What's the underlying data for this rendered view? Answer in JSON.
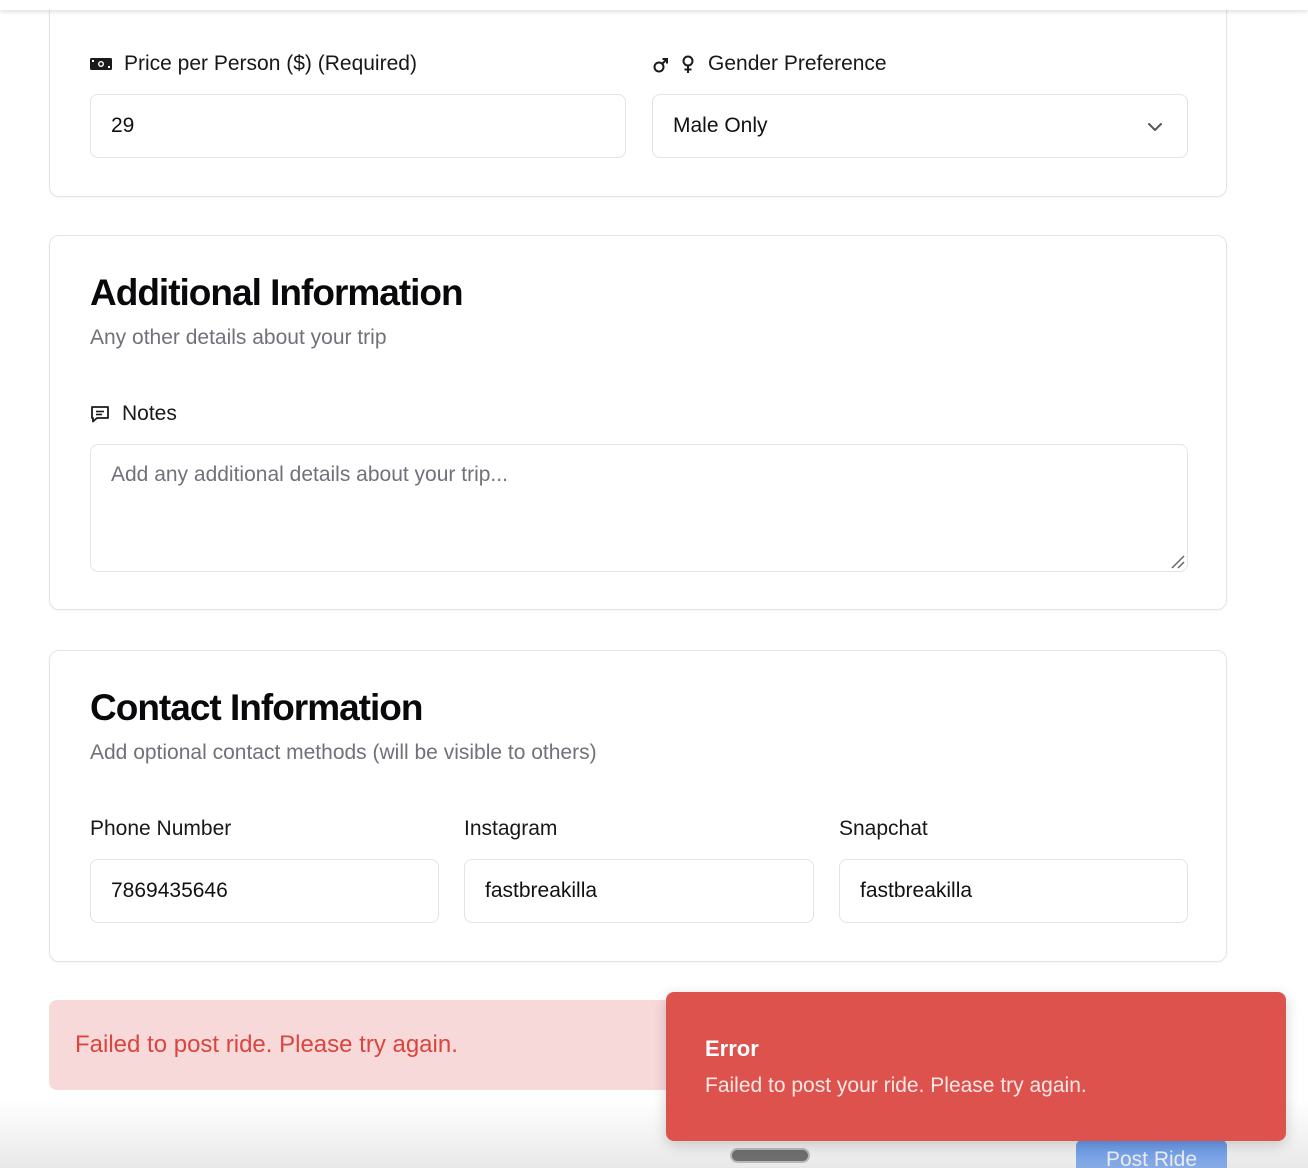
{
  "trip_details": {
    "price": {
      "label": "Price per Person ($) (Required)",
      "icon": "money-icon",
      "value": "29"
    },
    "gender": {
      "label": "Gender Preference",
      "icon": "gender-icon",
      "value": "Male Only"
    }
  },
  "additional": {
    "title": "Additional Information",
    "subtitle": "Any other details about your trip",
    "notes_label": "Notes",
    "notes_icon": "message-icon",
    "notes_placeholder": "Add any additional details about your trip..."
  },
  "contact": {
    "title": "Contact Information",
    "subtitle": "Add optional contact methods (will be visible to others)",
    "phone": {
      "label": "Phone Number",
      "value": "7869435646"
    },
    "instagram": {
      "label": "Instagram",
      "value": "fastbreakilla"
    },
    "snapchat": {
      "label": "Snapchat",
      "value": "fastbreakilla"
    }
  },
  "inline_error": "Failed to post ride. Please try again.",
  "toast": {
    "title": "Error",
    "description": "Failed to post your ride. Please try again."
  },
  "submit_label": "Post Ride",
  "colors": {
    "error_text": "#d9453f",
    "error_bg": "#f8d9da",
    "toast_bg": "#de524d",
    "primary": "#3b82f6"
  }
}
